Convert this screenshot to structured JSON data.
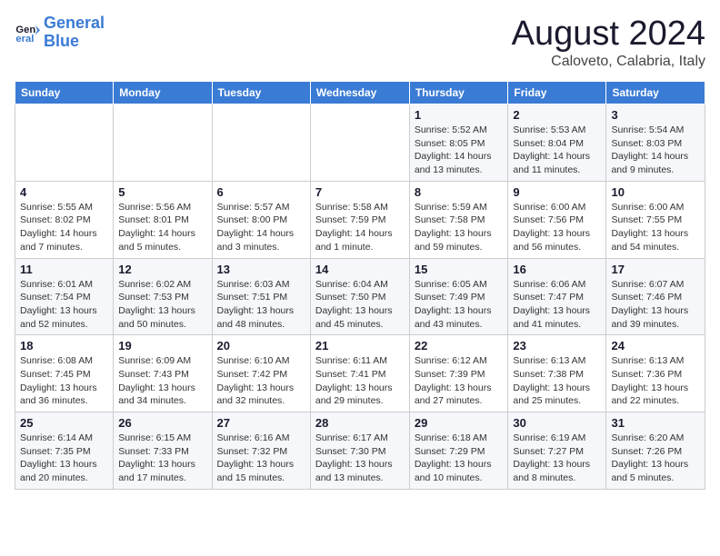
{
  "logo": {
    "line1": "General",
    "line2": "Blue"
  },
  "title": "August 2024",
  "subtitle": "Caloveto, Calabria, Italy",
  "days_of_week": [
    "Sunday",
    "Monday",
    "Tuesday",
    "Wednesday",
    "Thursday",
    "Friday",
    "Saturday"
  ],
  "weeks": [
    [
      {
        "day": "",
        "info": ""
      },
      {
        "day": "",
        "info": ""
      },
      {
        "day": "",
        "info": ""
      },
      {
        "day": "",
        "info": ""
      },
      {
        "day": "1",
        "info": "Sunrise: 5:52 AM\nSunset: 8:05 PM\nDaylight: 14 hours\nand 13 minutes."
      },
      {
        "day": "2",
        "info": "Sunrise: 5:53 AM\nSunset: 8:04 PM\nDaylight: 14 hours\nand 11 minutes."
      },
      {
        "day": "3",
        "info": "Sunrise: 5:54 AM\nSunset: 8:03 PM\nDaylight: 14 hours\nand 9 minutes."
      }
    ],
    [
      {
        "day": "4",
        "info": "Sunrise: 5:55 AM\nSunset: 8:02 PM\nDaylight: 14 hours\nand 7 minutes."
      },
      {
        "day": "5",
        "info": "Sunrise: 5:56 AM\nSunset: 8:01 PM\nDaylight: 14 hours\nand 5 minutes."
      },
      {
        "day": "6",
        "info": "Sunrise: 5:57 AM\nSunset: 8:00 PM\nDaylight: 14 hours\nand 3 minutes."
      },
      {
        "day": "7",
        "info": "Sunrise: 5:58 AM\nSunset: 7:59 PM\nDaylight: 14 hours\nand 1 minute."
      },
      {
        "day": "8",
        "info": "Sunrise: 5:59 AM\nSunset: 7:58 PM\nDaylight: 13 hours\nand 59 minutes."
      },
      {
        "day": "9",
        "info": "Sunrise: 6:00 AM\nSunset: 7:56 PM\nDaylight: 13 hours\nand 56 minutes."
      },
      {
        "day": "10",
        "info": "Sunrise: 6:00 AM\nSunset: 7:55 PM\nDaylight: 13 hours\nand 54 minutes."
      }
    ],
    [
      {
        "day": "11",
        "info": "Sunrise: 6:01 AM\nSunset: 7:54 PM\nDaylight: 13 hours\nand 52 minutes."
      },
      {
        "day": "12",
        "info": "Sunrise: 6:02 AM\nSunset: 7:53 PM\nDaylight: 13 hours\nand 50 minutes."
      },
      {
        "day": "13",
        "info": "Sunrise: 6:03 AM\nSunset: 7:51 PM\nDaylight: 13 hours\nand 48 minutes."
      },
      {
        "day": "14",
        "info": "Sunrise: 6:04 AM\nSunset: 7:50 PM\nDaylight: 13 hours\nand 45 minutes."
      },
      {
        "day": "15",
        "info": "Sunrise: 6:05 AM\nSunset: 7:49 PM\nDaylight: 13 hours\nand 43 minutes."
      },
      {
        "day": "16",
        "info": "Sunrise: 6:06 AM\nSunset: 7:47 PM\nDaylight: 13 hours\nand 41 minutes."
      },
      {
        "day": "17",
        "info": "Sunrise: 6:07 AM\nSunset: 7:46 PM\nDaylight: 13 hours\nand 39 minutes."
      }
    ],
    [
      {
        "day": "18",
        "info": "Sunrise: 6:08 AM\nSunset: 7:45 PM\nDaylight: 13 hours\nand 36 minutes."
      },
      {
        "day": "19",
        "info": "Sunrise: 6:09 AM\nSunset: 7:43 PM\nDaylight: 13 hours\nand 34 minutes."
      },
      {
        "day": "20",
        "info": "Sunrise: 6:10 AM\nSunset: 7:42 PM\nDaylight: 13 hours\nand 32 minutes."
      },
      {
        "day": "21",
        "info": "Sunrise: 6:11 AM\nSunset: 7:41 PM\nDaylight: 13 hours\nand 29 minutes."
      },
      {
        "day": "22",
        "info": "Sunrise: 6:12 AM\nSunset: 7:39 PM\nDaylight: 13 hours\nand 27 minutes."
      },
      {
        "day": "23",
        "info": "Sunrise: 6:13 AM\nSunset: 7:38 PM\nDaylight: 13 hours\nand 25 minutes."
      },
      {
        "day": "24",
        "info": "Sunrise: 6:13 AM\nSunset: 7:36 PM\nDaylight: 13 hours\nand 22 minutes."
      }
    ],
    [
      {
        "day": "25",
        "info": "Sunrise: 6:14 AM\nSunset: 7:35 PM\nDaylight: 13 hours\nand 20 minutes."
      },
      {
        "day": "26",
        "info": "Sunrise: 6:15 AM\nSunset: 7:33 PM\nDaylight: 13 hours\nand 17 minutes."
      },
      {
        "day": "27",
        "info": "Sunrise: 6:16 AM\nSunset: 7:32 PM\nDaylight: 13 hours\nand 15 minutes."
      },
      {
        "day": "28",
        "info": "Sunrise: 6:17 AM\nSunset: 7:30 PM\nDaylight: 13 hours\nand 13 minutes."
      },
      {
        "day": "29",
        "info": "Sunrise: 6:18 AM\nSunset: 7:29 PM\nDaylight: 13 hours\nand 10 minutes."
      },
      {
        "day": "30",
        "info": "Sunrise: 6:19 AM\nSunset: 7:27 PM\nDaylight: 13 hours\nand 8 minutes."
      },
      {
        "day": "31",
        "info": "Sunrise: 6:20 AM\nSunset: 7:26 PM\nDaylight: 13 hours\nand 5 minutes."
      }
    ]
  ]
}
